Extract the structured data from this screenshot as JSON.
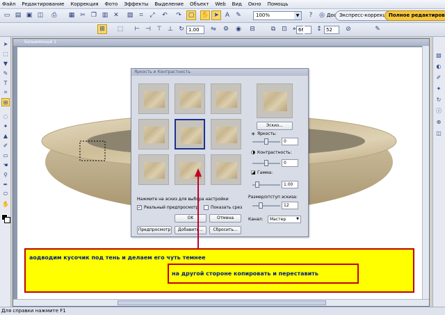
{
  "menu": [
    "Файл",
    "Редактирование",
    "Коррекция",
    "Фото",
    "Эффекты",
    "Выделение",
    "Объект",
    "Web",
    "Вид",
    "Окно",
    "Помощь"
  ],
  "toolbar": {
    "zoom": "100%",
    "access_label": "Доступ",
    "tab_express": "Экспресс-коррекция",
    "tab_full": "Полное редактиров..."
  },
  "toolbar2": {
    "angle": "1.00",
    "field_a": "66",
    "field_b": "52"
  },
  "document": {
    "title": "Безымянный 1"
  },
  "dialog": {
    "title": "Яркость и Контрастность",
    "preview_button": "Эскиз...",
    "brightness_label": "Яркость:",
    "brightness_value": "0",
    "contrast_label": "Контрастность:",
    "contrast_value": "0",
    "gamma_label": "Гамма:",
    "gamma_value": "1.00",
    "thumb_size_label": "Размер/отступ эскиза:",
    "thumb_size_value": "12",
    "channel_label": "Канал:",
    "channel_value": "Мастер",
    "hint": "Нажмите на эскиз для выбора настройки",
    "realtime_preview": "Реальный предпросмотр",
    "show_cut": "Показать срез",
    "ok": "OK",
    "cancel": "Отмена",
    "preview": "Предпросмотр",
    "add": "Добавить...",
    "reset": "Сбросить..."
  },
  "notes": {
    "line1": "аодводим кусочик под тень и делаем его чуть темнее",
    "line2": "на другой стороне копировать и переставить"
  },
  "status": "Для справки нажмите F1",
  "colors": {
    "note_bg": "#ffff00",
    "note_border": "#c00000",
    "note_text": "#001a80",
    "arrow": "#c0002a",
    "selected_thumb": "#1e2f8f"
  }
}
